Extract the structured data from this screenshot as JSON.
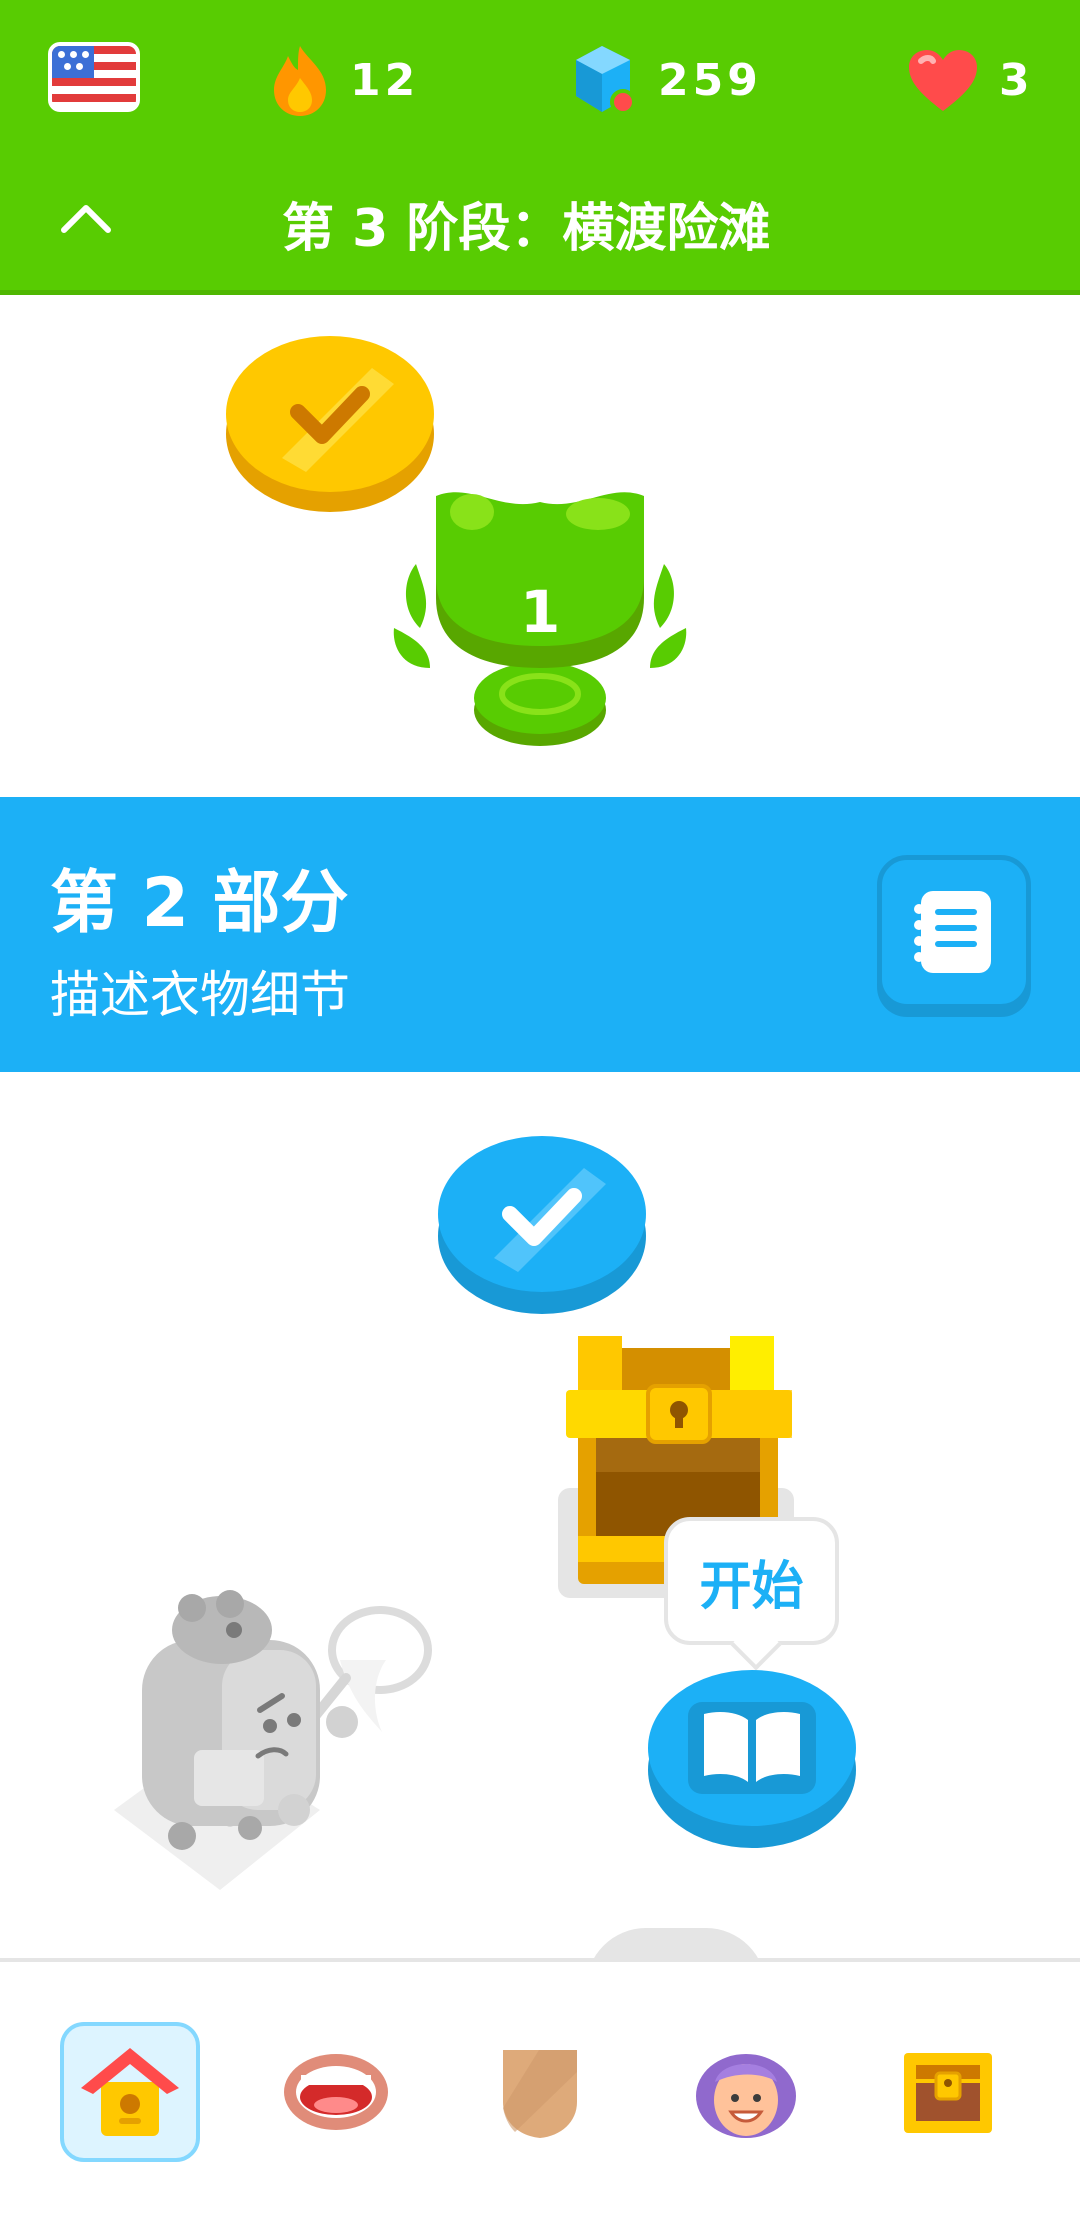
{
  "header": {
    "streak": "12",
    "gems": "259",
    "hearts": "3",
    "stage_title": "第 3 阶段：横渡险滩"
  },
  "path": {
    "trophy_level": "1"
  },
  "unit": {
    "title": "第 2 部分",
    "subtitle": "描述衣物细节"
  },
  "lesson": {
    "start_label": "开始"
  },
  "colors": {
    "green": "#58cc02",
    "blue": "#1cb0f6",
    "gold": "#ffc800"
  },
  "icons": {
    "flag": "us-flag-icon",
    "streak": "flame-icon",
    "gems": "gem-icon",
    "hearts": "heart-icon",
    "collapse": "chevron-up-icon",
    "guidebook": "notebook-icon",
    "lesson": "book-icon"
  },
  "bottom_nav": [
    "home-icon",
    "speaking-icon",
    "leagues-icon",
    "profile-icon",
    "shop-chest-icon"
  ]
}
